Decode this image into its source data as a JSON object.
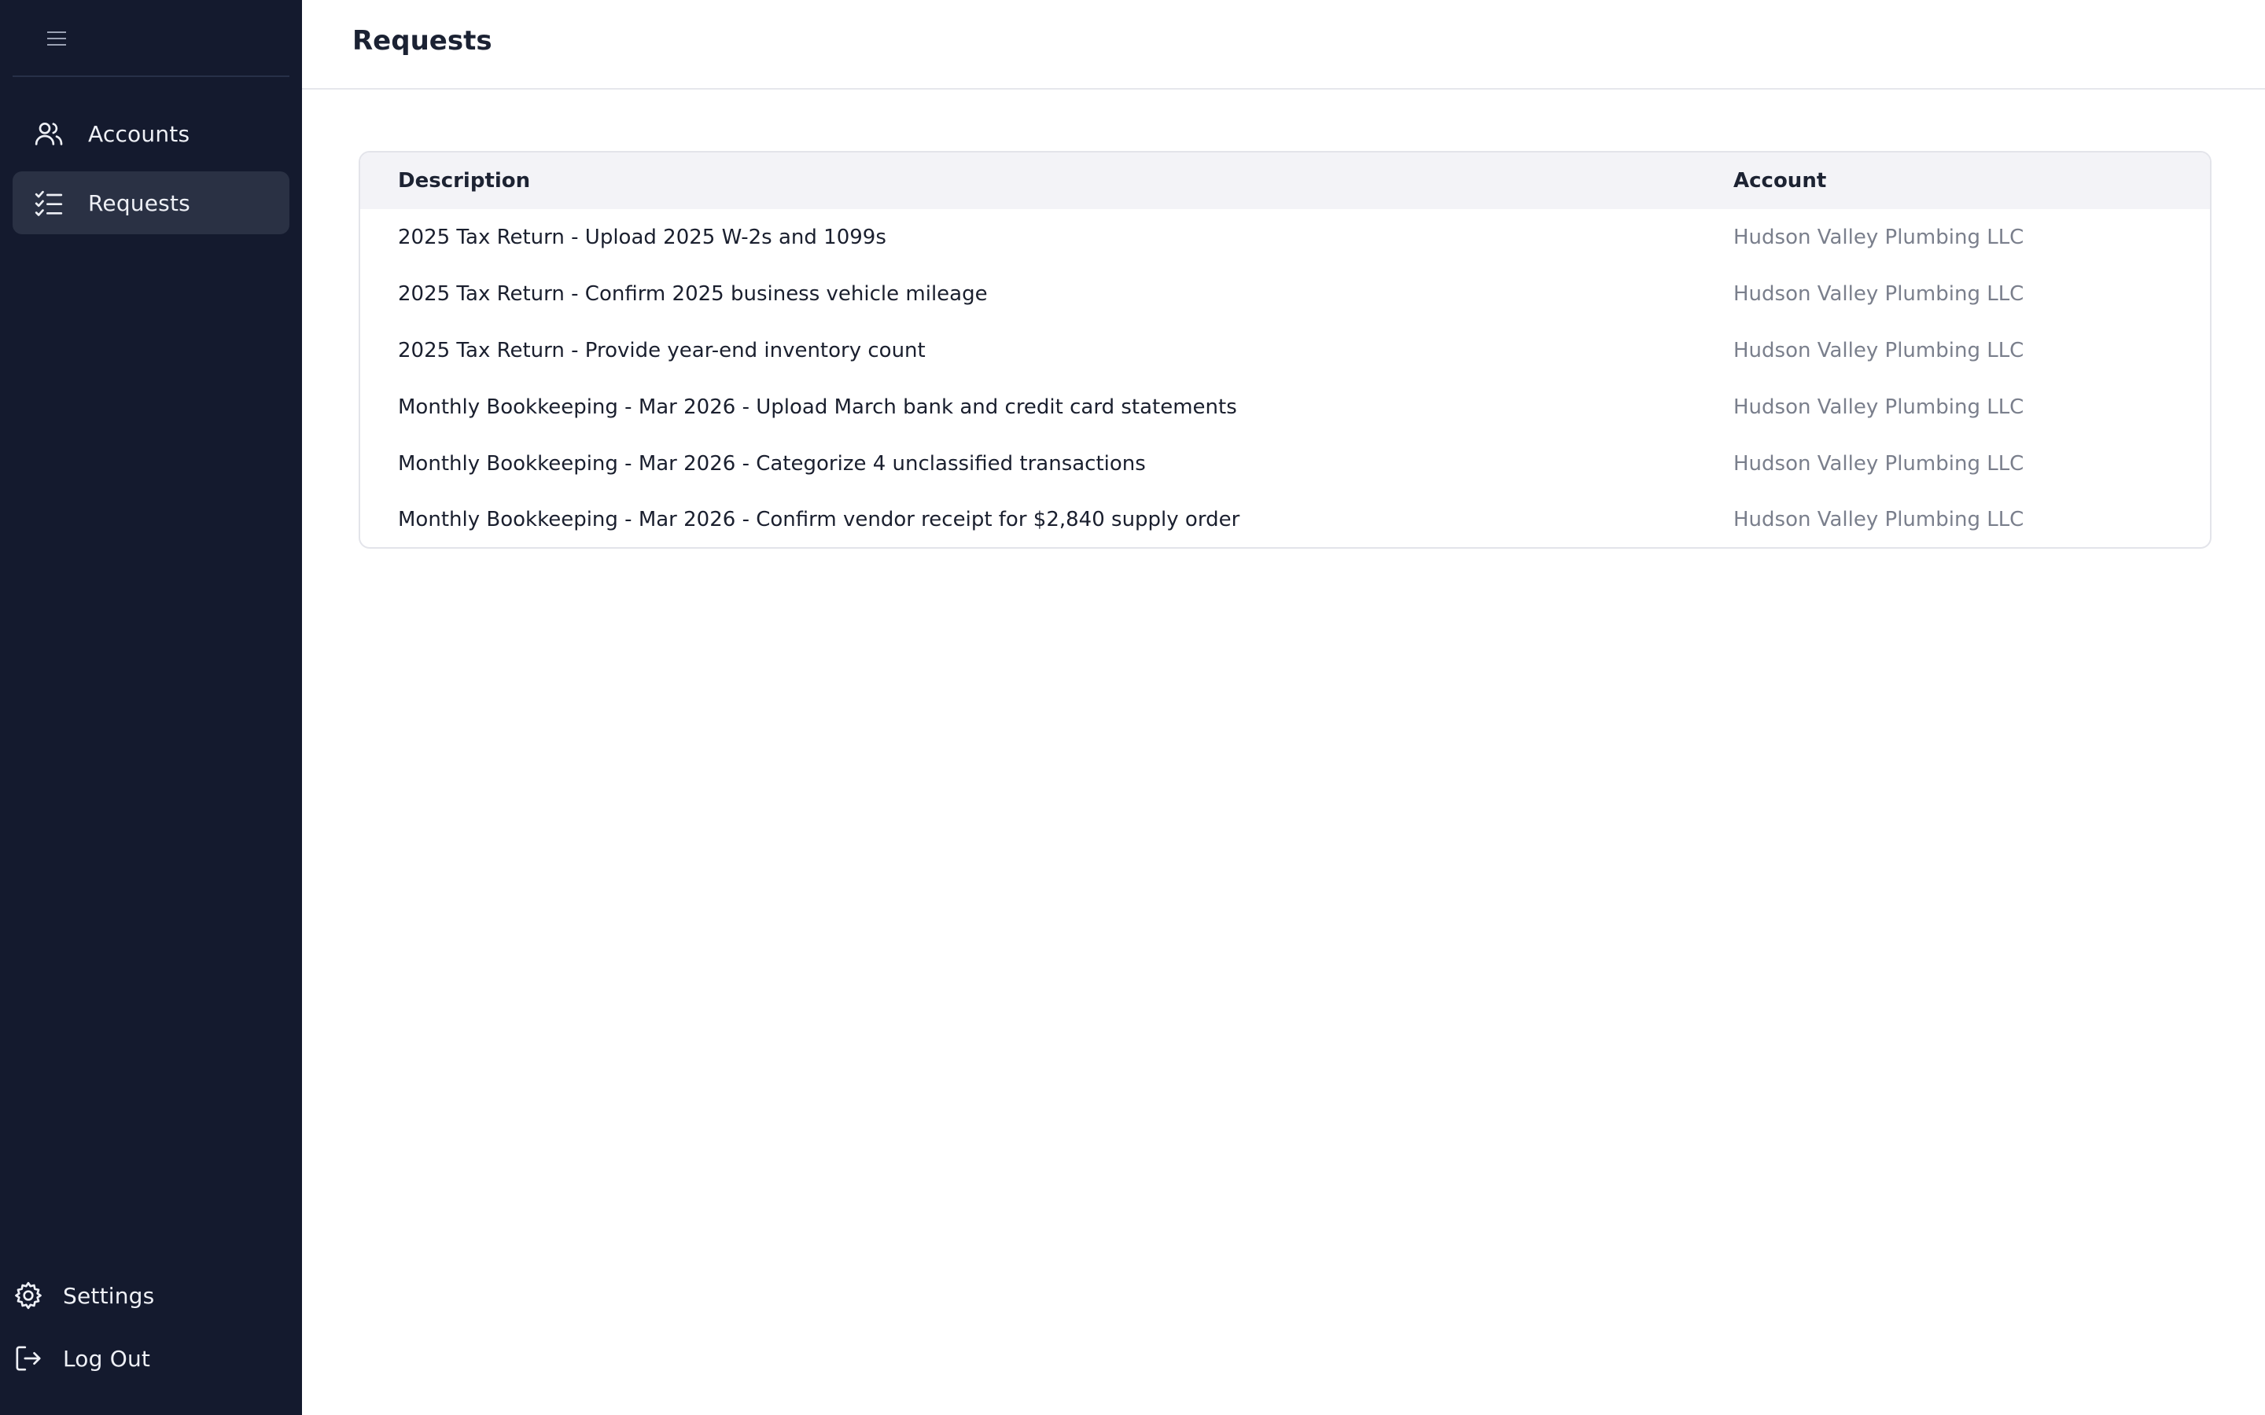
{
  "sidebar": {
    "toggle_icon": "hamburger-menu-icon",
    "nav": [
      {
        "label": "Accounts",
        "icon": "users-icon",
        "active": false
      },
      {
        "label": "Requests",
        "icon": "checklist-icon",
        "active": true
      }
    ],
    "bottom": [
      {
        "label": "Settings",
        "icon": "gear-icon"
      },
      {
        "label": "Log Out",
        "icon": "logout-icon"
      }
    ],
    "colors": {
      "background": "#141a2e",
      "active_item": "#2a3144"
    }
  },
  "header": {
    "title": "Requests"
  },
  "table": {
    "columns": [
      "Description",
      "Account"
    ],
    "rows": [
      {
        "description": "2025 Tax Return - Upload 2025 W-2s and 1099s",
        "account": "Hudson Valley Plumbing LLC"
      },
      {
        "description": "2025 Tax Return - Confirm 2025 business vehicle mileage",
        "account": "Hudson Valley Plumbing LLC"
      },
      {
        "description": "2025 Tax Return - Provide year-end inventory count",
        "account": "Hudson Valley Plumbing LLC"
      },
      {
        "description": "Monthly Bookkeeping - Mar 2026 - Upload March bank and credit card statements",
        "account": "Hudson Valley Plumbing LLC"
      },
      {
        "description": "Monthly Bookkeeping - Mar 2026 - Categorize 4 unclassified transactions",
        "account": "Hudson Valley Plumbing LLC"
      },
      {
        "description": "Monthly Bookkeeping - Mar 2026 - Confirm vendor receipt for $2,840 supply order",
        "account": "Hudson Valley Plumbing LLC"
      }
    ]
  }
}
